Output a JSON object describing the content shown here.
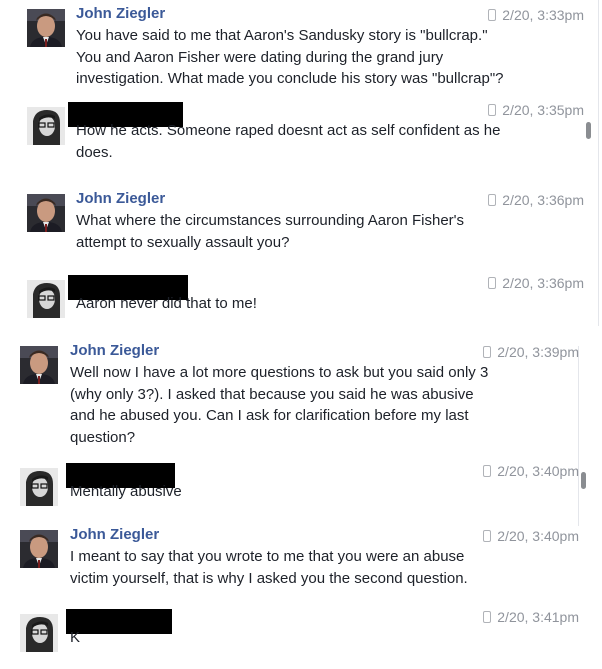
{
  "panel1": {
    "messages": [
      {
        "name": "John Ziegler",
        "avatar": "profile-photo",
        "time": "2/20, 3:33pm",
        "lines": [
          "You have said to me that Aaron's Sandusky story is \"bullcrap.\"",
          "You and Aaron Fisher were dating during the grand jury",
          "investigation. What made you conclude his story was \"bullcrap\"?"
        ]
      },
      {
        "name": "",
        "avatar": "profile-photo-bw",
        "time": "2/20, 3:35pm",
        "lines": [
          "How he acts. Someone raped doesnt act as self confident as he",
          "does."
        ]
      },
      {
        "name": "John Ziegler",
        "avatar": "profile-photo",
        "time": "2/20, 3:36pm",
        "lines": [
          "What where the circumstances surrounding Aaron Fisher's",
          "attempt to sexually assault you?"
        ]
      },
      {
        "name": "",
        "avatar": "profile-photo-bw",
        "time": "2/20, 3:36pm",
        "lines": [
          "Aaron never did that to me!"
        ]
      }
    ]
  },
  "panel2": {
    "messages": [
      {
        "name": "John Ziegler",
        "avatar": "profile-photo",
        "time": "2/20, 3:39pm",
        "lines": [
          "Well now I have a lot more questions to ask but you said only 3",
          "(why only 3?). I asked that because you said he was abusive",
          "and he abused you. Can I ask for clarification before my last",
          "question?"
        ]
      },
      {
        "name": "",
        "avatar": "profile-photo-bw",
        "time": "2/20, 3:40pm",
        "lines": [
          "Mentally abusive"
        ]
      },
      {
        "name": "John Ziegler",
        "avatar": "profile-photo",
        "time": "2/20, 3:40pm",
        "lines": [
          "I meant to say that you wrote to me that you were an abuse",
          "victim yourself, that is why I asked you the second question."
        ]
      },
      {
        "name": "",
        "avatar": "profile-photo-bw",
        "time": "2/20, 3:41pm",
        "lines": [
          "K"
        ]
      }
    ]
  },
  "colors": {
    "name": "#3b5998",
    "time": "#90949c",
    "text": "#1d2129",
    "redaction": "#000000"
  }
}
